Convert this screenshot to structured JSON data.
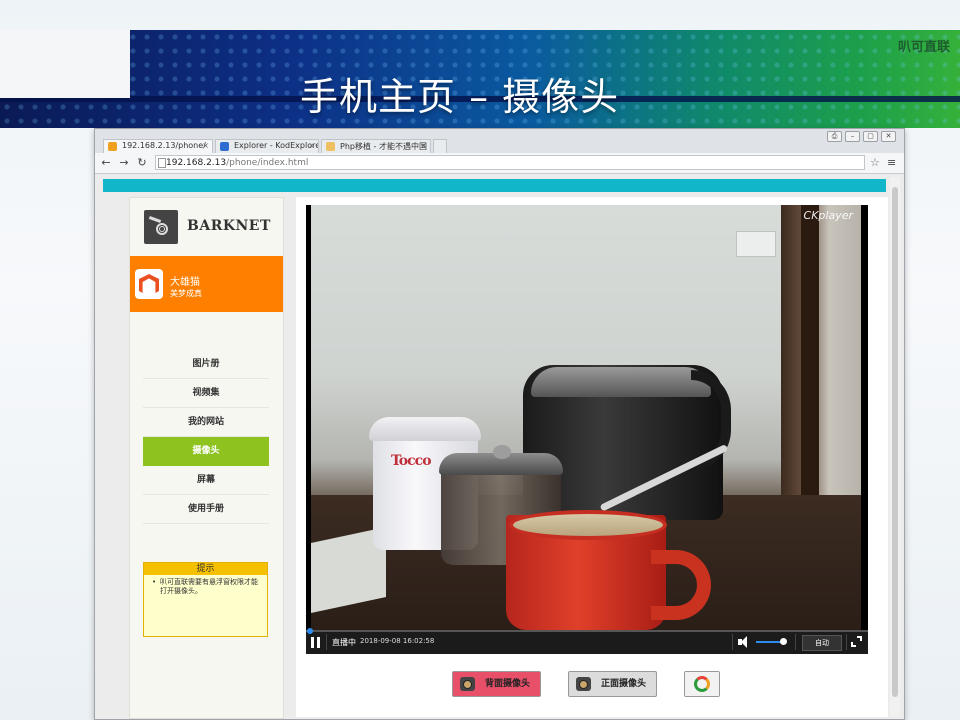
{
  "slide": {
    "brand_tag": "叭可直联",
    "title": "手机主页 – 摄像头"
  },
  "browser": {
    "tabs": [
      {
        "label": "192.168.2.13/phone/",
        "icon_color": "#f0a020"
      },
      {
        "label": "Explorer - KodExplorer",
        "icon_color": "#2d6cd0"
      },
      {
        "label": "Php移植 - 才能不遇中国",
        "icon_color": "#f0c060"
      }
    ],
    "tab_close": "×",
    "window_controls": [
      "⎙",
      "–",
      "▢",
      "✕"
    ],
    "address": {
      "host": "192.168.2.13",
      "path": "/phone/index.html"
    },
    "icons": [
      "back-arrow",
      "forward-arrow",
      "reload",
      "star",
      "menu"
    ]
  },
  "sidebar": {
    "brand": "BARKNET",
    "user": {
      "name": "大雄猫",
      "subtitle": "美梦成真"
    },
    "menu": [
      {
        "label": "图片册"
      },
      {
        "label": "视频集"
      },
      {
        "label": "我的网站"
      },
      {
        "label": "摄像头",
        "active": true
      },
      {
        "label": "屏幕"
      },
      {
        "label": "使用手册"
      }
    ],
    "tip": {
      "title": "提示",
      "text": "叭可直联需要有悬浮窗权限才能打开摄像头。"
    }
  },
  "player": {
    "watermark": "CKplayer",
    "status": "直播中",
    "timestamp": "2018-09-08 16:02:58",
    "volume": 0.8,
    "quality": "自动",
    "video_text": "Tocco"
  },
  "buttons": {
    "back_camera": "背面摄像头",
    "front_camera": "正面摄像头"
  },
  "colors": {
    "accent_bar": "#12b6c9",
    "user_card": "#ff7f00",
    "menu_active": "#8dc21f",
    "tip_header": "#f5c000",
    "back_button": "#e8506a"
  }
}
